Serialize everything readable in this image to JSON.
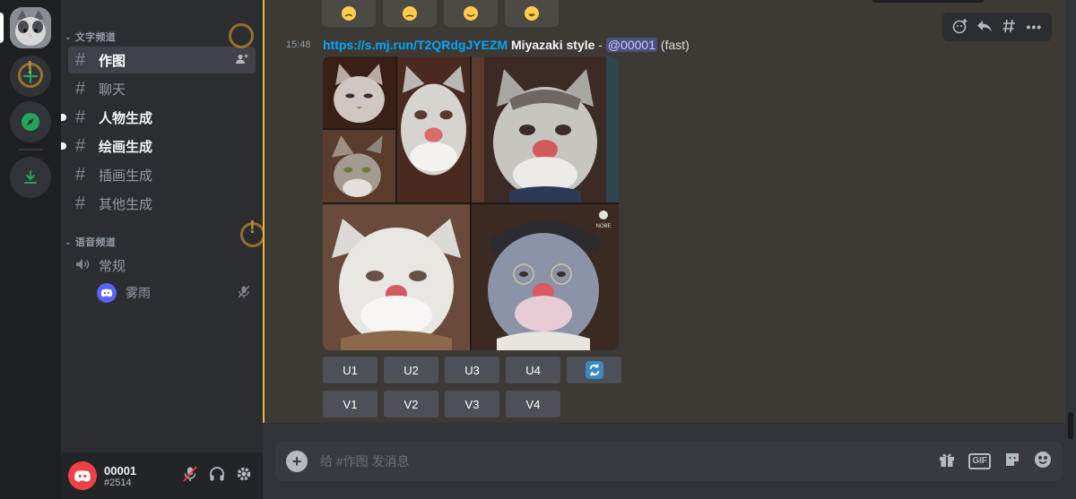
{
  "server_rail": {
    "add_server_icon": "plus-icon",
    "explore_icon": "compass-icon",
    "download_icon": "download-icon"
  },
  "sidebar": {
    "text_category": "文字频道",
    "voice_category": "语音频道",
    "text_channels": [
      {
        "name": "作图",
        "state": "active"
      },
      {
        "name": "聊天",
        "state": "normal"
      },
      {
        "name": "人物生成",
        "state": "unread"
      },
      {
        "name": "绘画生成",
        "state": "unread"
      },
      {
        "name": "插画生成",
        "state": "normal"
      },
      {
        "name": "其他生成",
        "state": "normal"
      }
    ],
    "voice_channel": "常规",
    "voice_user": "雾雨"
  },
  "user": {
    "name": "00001",
    "tag": "#2514"
  },
  "message": {
    "time": "15:48",
    "link": "https://s.mj.run/T2QRdgJYEZM",
    "prompt": " Miyazaki style",
    "sep": " - ",
    "mention": "@00001",
    "mode": " (fast)"
  },
  "buttons": {
    "upscale": [
      "U1",
      "U2",
      "U3",
      "U4"
    ],
    "variation": [
      "V1",
      "V2",
      "V3",
      "V4"
    ],
    "refresh_icon": "refresh-icon"
  },
  "composer": {
    "placeholder": "给 #作图 发消息"
  },
  "colors": {
    "accent": "#5865f2",
    "highlight_border": "#f0b232",
    "link": "#00a8fc"
  }
}
